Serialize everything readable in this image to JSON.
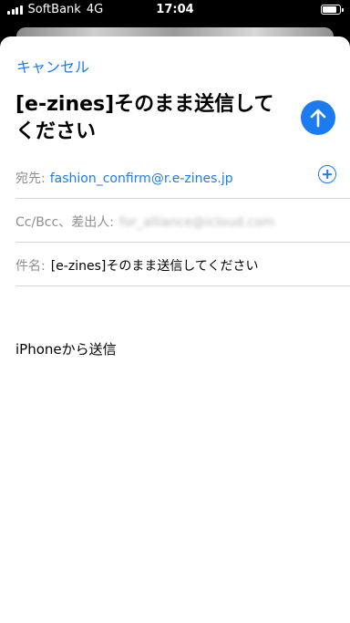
{
  "status": {
    "carrier": "SoftBank",
    "network": "4G",
    "time": "17:04"
  },
  "compose": {
    "cancel_label": "キャンセル",
    "title": "[e-zines]そのまま送信してください",
    "to_label": "宛先:",
    "to_value": "fashion_confirm@r.e-zines.jp",
    "cc_label": "Cc/Bcc、差出人:",
    "from_value": "for_alliance@icloud.com",
    "subject_label": "件名:",
    "subject_value": "[e-zines]そのまま送信してください",
    "signature": "iPhoneから送信"
  },
  "colors": {
    "accent": "#1a7cf0",
    "label": "#8e8e93"
  },
  "icons": {
    "send": "arrow-up-icon",
    "add": "plus-circle-icon"
  }
}
